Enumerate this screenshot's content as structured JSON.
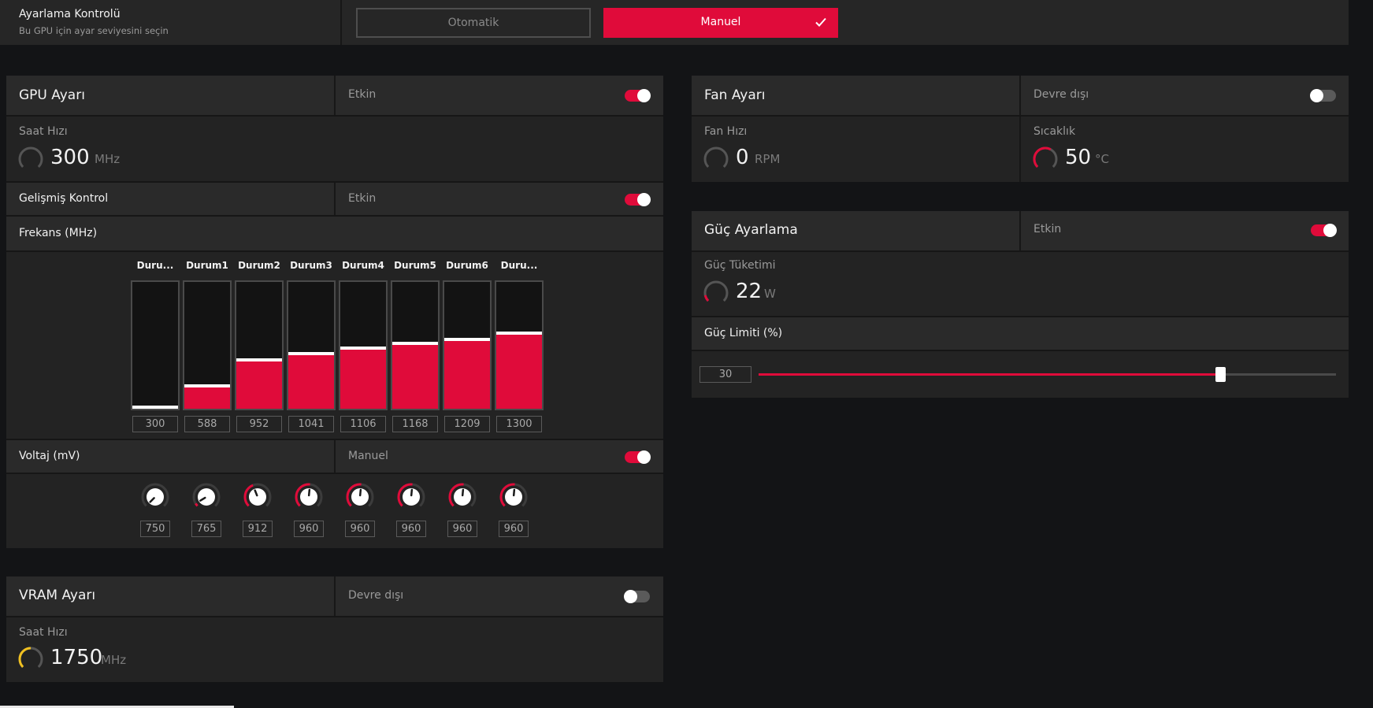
{
  "tuning_control": {
    "title": "Ayarlama Kontrolü",
    "subtitle": "Bu GPU için ayar seviyesini seçin",
    "auto_label": "Otomatik",
    "manual_label": "Manuel",
    "selected": "Manuel"
  },
  "gpu": {
    "title": "GPU Ayarı",
    "status": "Etkin",
    "enabled": true,
    "clock_label": "Saat Hızı",
    "clock_value": "300",
    "clock_unit": "MHz",
    "advanced_label": "Gelişmiş Kontrol",
    "advanced_status": "Etkin",
    "advanced_enabled": true,
    "frequency_label": "Frekans (MHz)",
    "states": [
      {
        "label": "Duru...",
        "freq": "300",
        "fill": 0.02
      },
      {
        "label": "Durum1",
        "freq": "588",
        "fill": 0.19
      },
      {
        "label": "Durum2",
        "freq": "952",
        "fill": 0.4
      },
      {
        "label": "Durum3",
        "freq": "1041",
        "fill": 0.45
      },
      {
        "label": "Durum4",
        "freq": "1106",
        "fill": 0.49
      },
      {
        "label": "Durum5",
        "freq": "1168",
        "fill": 0.53
      },
      {
        "label": "Durum6",
        "freq": "1209",
        "fill": 0.56
      },
      {
        "label": "Duru...",
        "freq": "1300",
        "fill": 0.61
      }
    ],
    "voltage_label": "Voltaj (mV)",
    "voltage_status": "Manuel",
    "voltage_enabled": true,
    "voltages": [
      {
        "value": "750",
        "level": 0.0
      },
      {
        "value": "765",
        "level": 0.05
      },
      {
        "value": "912",
        "level": 0.42
      },
      {
        "value": "960",
        "level": 0.52
      },
      {
        "value": "960",
        "level": 0.52
      },
      {
        "value": "960",
        "level": 0.52
      },
      {
        "value": "960",
        "level": 0.52
      },
      {
        "value": "960",
        "level": 0.52
      }
    ]
  },
  "vram": {
    "title": "VRAM Ayarı",
    "status": "Devre dışı",
    "enabled": false,
    "clock_label": "Saat Hızı",
    "clock_value": "1750",
    "clock_unit": "MHz"
  },
  "fan": {
    "title": "Fan Ayarı",
    "status": "Devre dışı",
    "enabled": false,
    "speed_label": "Fan Hızı",
    "speed_value": "0",
    "speed_unit": "RPM",
    "temp_label": "Sıcaklık",
    "temp_value": "50",
    "temp_unit": "°C"
  },
  "power": {
    "title": "Güç Ayarlama",
    "status": "Etkin",
    "enabled": true,
    "consumption_label": "Güç Tüketimi",
    "consumption_value": "22",
    "consumption_unit": "W",
    "limit_label": "Güç Limiti (%)",
    "limit_value": "30",
    "limit_fraction": 0.8
  },
  "colors": {
    "accent": "#e00b3a",
    "vram_gauge": "#f0c020",
    "panel": "#232323",
    "header": "#2a2a2a"
  }
}
